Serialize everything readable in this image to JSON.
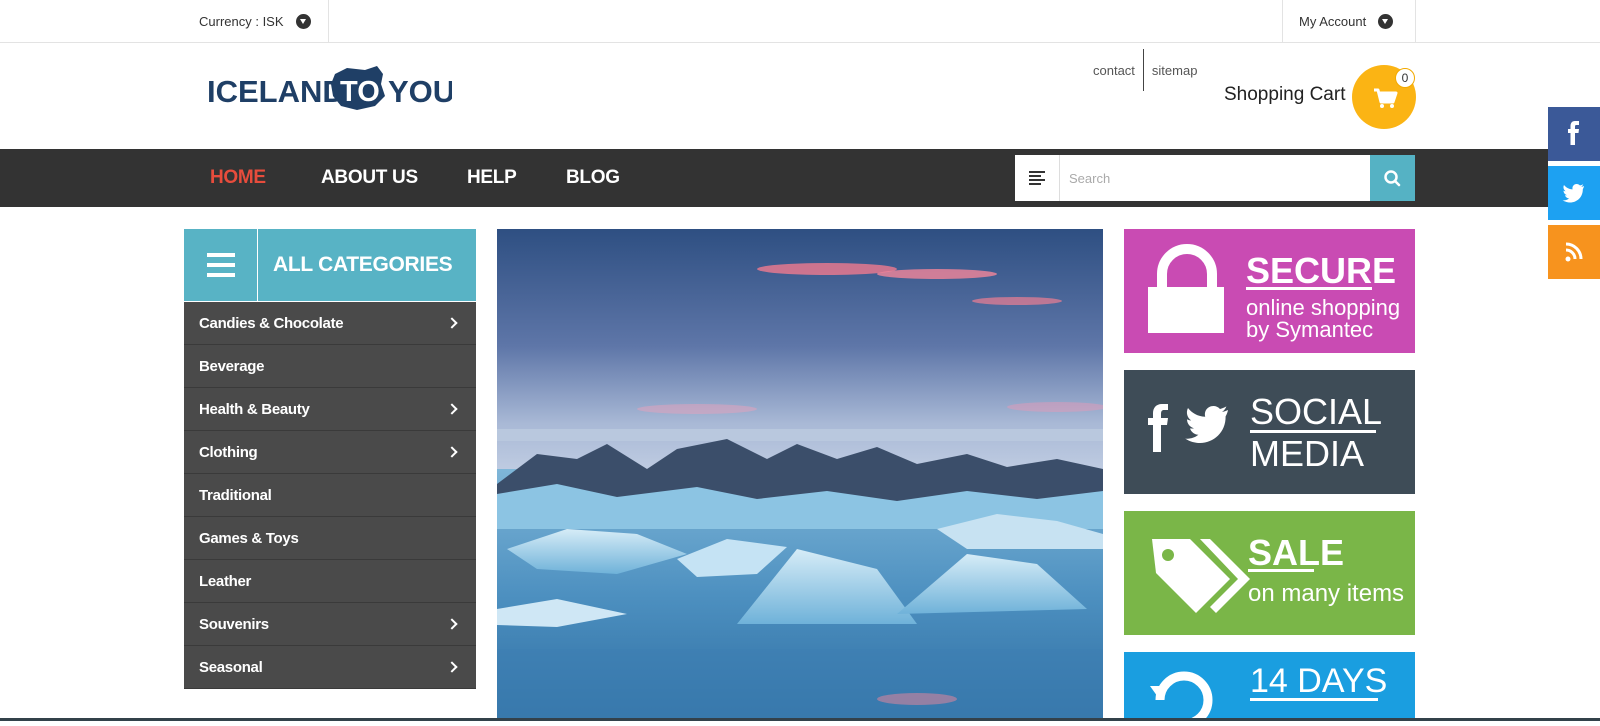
{
  "topbar": {
    "currency_label": "Currency : ISK",
    "account_label": "My Account"
  },
  "logo": {
    "part1": "ICELAND",
    "part2": "TO",
    "part3": "YOU"
  },
  "toplinks": {
    "contact": "contact",
    "sitemap": "sitemap"
  },
  "cart": {
    "label": "Shopping Cart",
    "count": "0"
  },
  "nav": {
    "items": [
      "HOME",
      "ABOUT US",
      "HELP",
      "BLOG"
    ],
    "active_index": 0
  },
  "search": {
    "placeholder": "Search",
    "value": ""
  },
  "social": [
    "facebook-icon",
    "twitter-icon",
    "rss-icon"
  ],
  "categories": {
    "title": "ALL CATEGORIES",
    "items": [
      {
        "label": "Candies & Chocolate",
        "has_sub": true
      },
      {
        "label": "Beverage",
        "has_sub": false
      },
      {
        "label": "Health & Beauty",
        "has_sub": true
      },
      {
        "label": "Clothing",
        "has_sub": true
      },
      {
        "label": "Traditional",
        "has_sub": false
      },
      {
        "label": "Games & Toys",
        "has_sub": false
      },
      {
        "label": "Leather",
        "has_sub": false
      },
      {
        "label": "Souvenirs",
        "has_sub": true
      },
      {
        "label": "Seasonal",
        "has_sub": true
      }
    ]
  },
  "promos": {
    "secure": {
      "title": "SECURE",
      "line1": "online shopping",
      "line2": "by Symantec",
      "color": "#c94bb3"
    },
    "social": {
      "title1": "SOCIAL",
      "title2": "MEDIA",
      "color": "#3e4c57"
    },
    "sale": {
      "title": "SALE",
      "line1": "on many items",
      "color": "#7ab648"
    },
    "returns": {
      "title": "14 DAYS",
      "color": "#1a9ee0"
    }
  },
  "colors": {
    "accent": "#58b3c5",
    "nav_bg": "#333333",
    "nav_active": "#e74c3c",
    "cart": "#fbb414",
    "facebook": "#3b5998",
    "twitter": "#1da1f2",
    "rss": "#f7931e"
  }
}
